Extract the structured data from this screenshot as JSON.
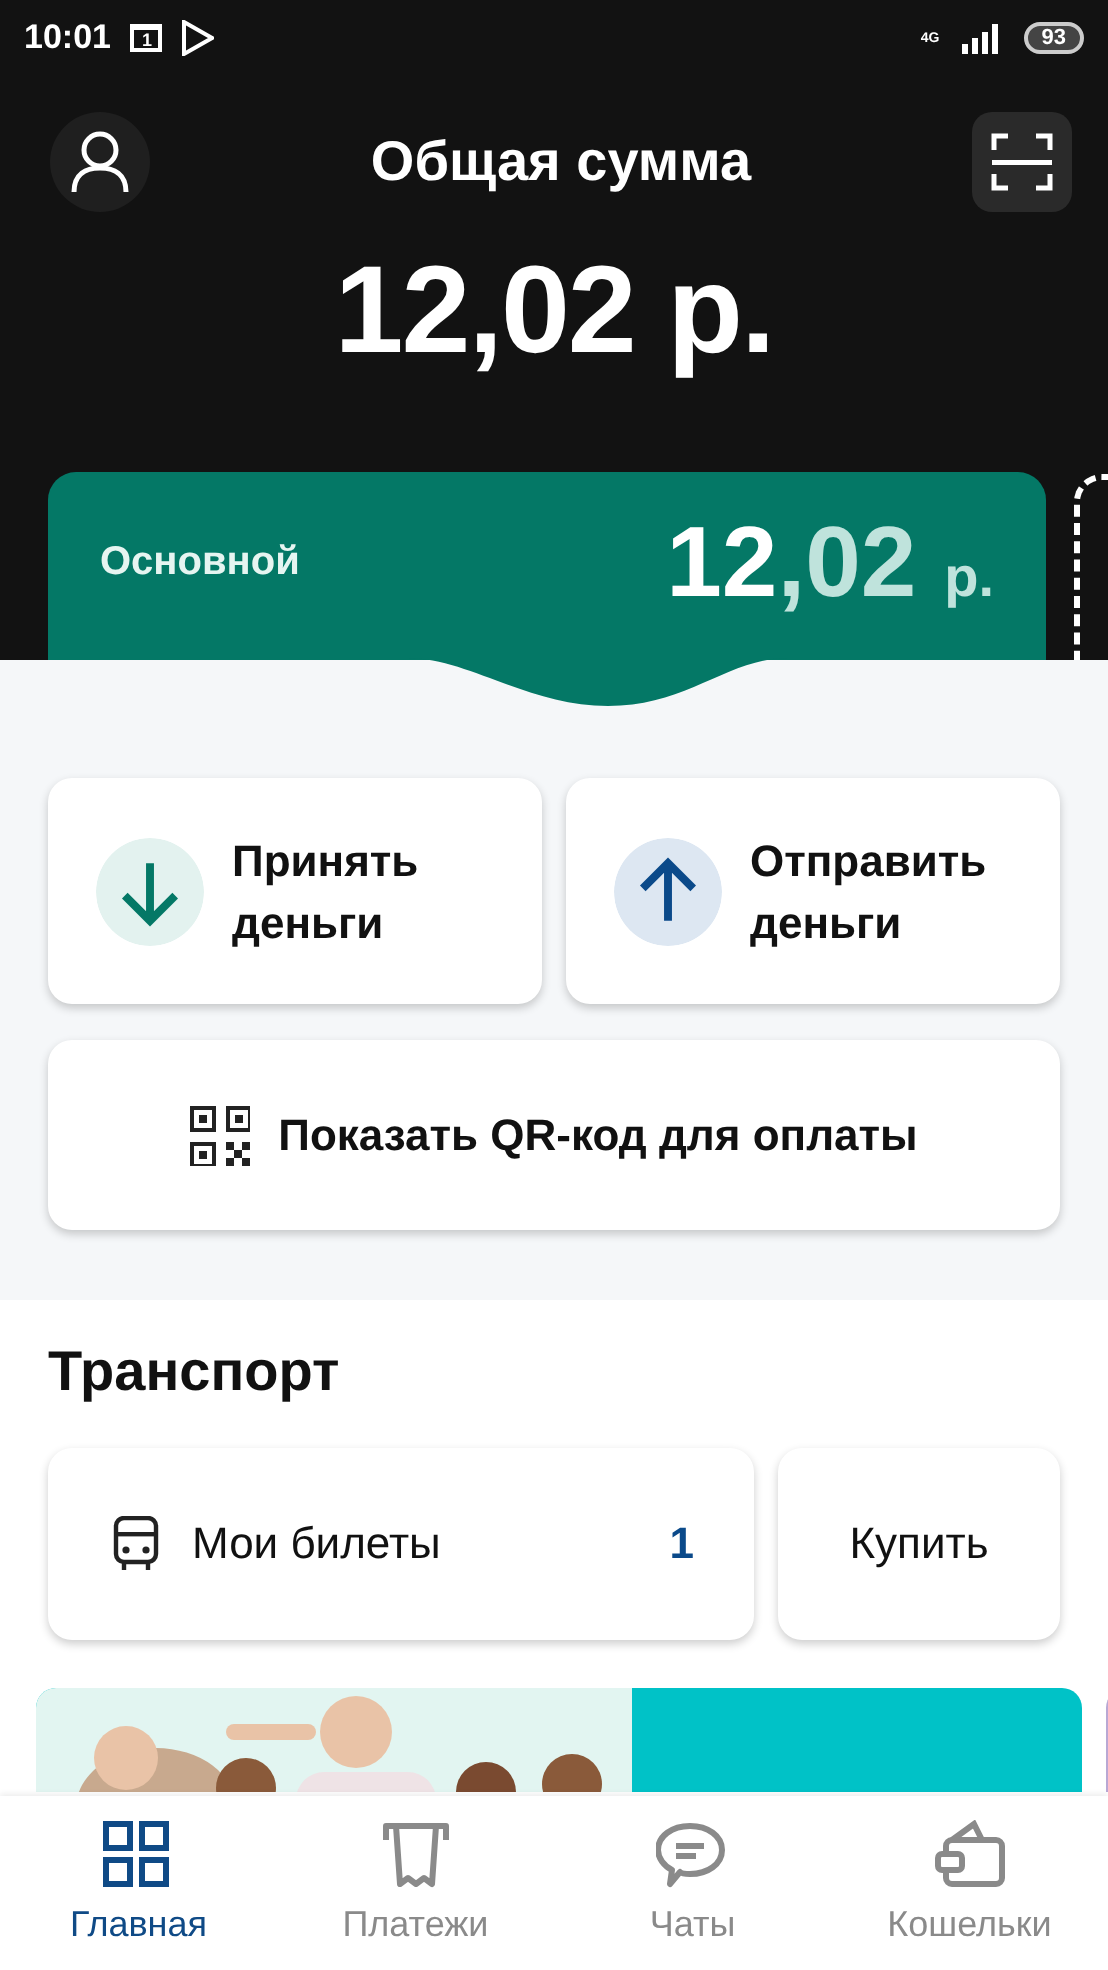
{
  "status_bar": {
    "time": "10:01",
    "calendar_day": "1",
    "network": "4G",
    "battery": "93"
  },
  "header": {
    "title": "Общая сумма",
    "total": "12,02 р."
  },
  "wallet_card": {
    "name": "Основной",
    "amount_int": "12",
    "amount_frac": ",02",
    "currency": "р."
  },
  "actions": [
    {
      "kind": "receive",
      "label": "Принять деньги"
    },
    {
      "kind": "send",
      "label": "Отправить деньги"
    }
  ],
  "qr_button": {
    "label": "Показать QR-код для оплаты"
  },
  "transport": {
    "title": "Транспорт",
    "tickets_label": "Мои билеты",
    "tickets_count": "1",
    "buy_label": "Купить"
  },
  "banners": [
    {
      "kind": "picture"
    },
    {
      "kind": "teal"
    },
    {
      "kind": "lilac"
    }
  ],
  "nav": [
    {
      "kind": "home",
      "label": "Главная",
      "selected": true
    },
    {
      "kind": "payments",
      "label": "Платежи",
      "selected": false
    },
    {
      "kind": "chats",
      "label": "Чаты",
      "selected": false
    },
    {
      "kind": "wallets",
      "label": "Кошельки",
      "selected": false
    }
  ]
}
